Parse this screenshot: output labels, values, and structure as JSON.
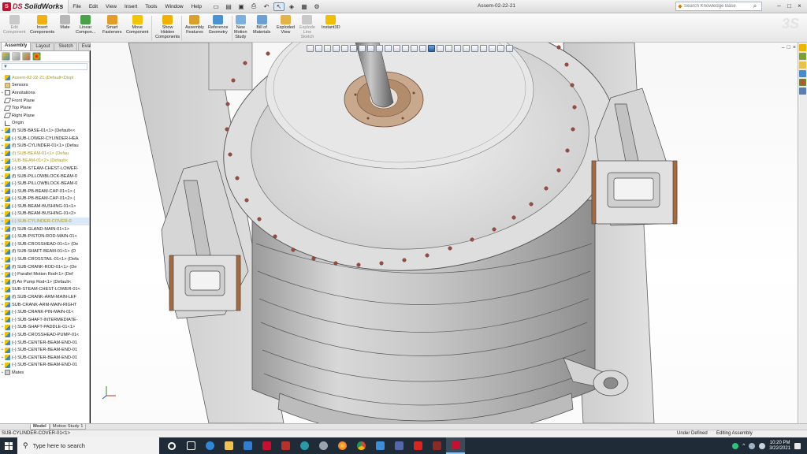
{
  "app": {
    "logo_mark": "S",
    "logo_prefix": "DS ",
    "logo_name": "SolidWorks",
    "document_title": "Assem-02-22-21"
  },
  "menu": [
    "File",
    "Edit",
    "View",
    "Insert",
    "Tools",
    "Window",
    "Help"
  ],
  "search": {
    "placeholder": "Search Knowledge Base"
  },
  "commands": [
    {
      "label": "Edit\nComponent",
      "icon_color": "#c9c9c9",
      "enabled": false
    },
    {
      "label": "Insert\nComponents",
      "icon_color": "#f3b10f",
      "enabled": true
    },
    {
      "label": "Mate",
      "icon_color": "#b7b7b7",
      "enabled": true
    },
    {
      "label": "Linear\nCompon...",
      "icon_color": "#4aa14a",
      "enabled": true
    },
    {
      "label": "Smart\nFasteners",
      "icon_color": "#e39b2a",
      "enabled": true
    },
    {
      "label": "Move\nComponent",
      "icon_color": "#f2c500",
      "enabled": true
    },
    {
      "label": "Show\nHidden\nComponents",
      "icon_color": "#f0b400",
      "enabled": true
    },
    {
      "label": "Assembly\nFeatures",
      "icon_color": "#d9a02a",
      "enabled": true
    },
    {
      "label": "Reference\nGeometry",
      "icon_color": "#4a93d0",
      "enabled": true
    },
    {
      "label": "New\nMotion\nStudy",
      "icon_color": "#7cb0e0",
      "enabled": true
    },
    {
      "label": "Bill of\nMaterials",
      "icon_color": "#6d9fd2",
      "enabled": true
    },
    {
      "label": "Exploded\nView",
      "icon_color": "#e2b445",
      "enabled": true
    },
    {
      "label": "Explode\nLine\nSketch",
      "icon_color": "#c9c9c9",
      "enabled": false
    },
    {
      "label": "Instant3D",
      "icon_color": "#f0c000",
      "enabled": true
    }
  ],
  "panel_tabs": [
    "Assembly",
    "Layout",
    "Sketch",
    "Evaluate"
  ],
  "tree": [
    {
      "label": "Assem-02-22-21  (Default<Displ",
      "icon": "asm",
      "exp": "",
      "style": "yellow"
    },
    {
      "label": "Sensors",
      "icon": "sensor",
      "exp": "",
      "style": ""
    },
    {
      "label": "Annotations",
      "icon": "annot",
      "exp": "+",
      "style": ""
    },
    {
      "label": "Front Plane",
      "icon": "plane",
      "exp": "",
      "style": ""
    },
    {
      "label": "Top Plane",
      "icon": "plane",
      "exp": "",
      "style": ""
    },
    {
      "label": "Right Plane",
      "icon": "plane",
      "exp": "",
      "style": ""
    },
    {
      "label": "Origin",
      "icon": "origin",
      "exp": "",
      "style": ""
    },
    {
      "label": "(f) SUB-BASE-01<1> (Default<<",
      "icon": "asm",
      "exp": "+",
      "style": ""
    },
    {
      "label": "(-) SUB-LOWER-CYLINDER-HEA",
      "icon": "asm",
      "exp": "+",
      "style": ""
    },
    {
      "label": "(f) SUB-CYLINDER-01<1> (Defau",
      "icon": "asm",
      "exp": "+",
      "style": ""
    },
    {
      "label": "(f) SUB-BEAM-01<1> (Defau",
      "icon": "asm",
      "exp": "+",
      "style": "yellow"
    },
    {
      "label": "SUB-BEAM-01<2> (Default<",
      "icon": "asm",
      "exp": "+",
      "style": "yellow"
    },
    {
      "label": "(-) SUB-STEAM-CHEST-LOWER-",
      "icon": "asm",
      "exp": "+",
      "style": ""
    },
    {
      "label": "(f) SUB-PILLOWBLOCK-BEAM-0",
      "icon": "asm",
      "exp": "+",
      "style": ""
    },
    {
      "label": "(-) SUB-PILLOWBLOCK-BEAM-0",
      "icon": "asm",
      "exp": "+",
      "style": ""
    },
    {
      "label": "(-) SUB-PB-BEAM-CAP-01<1> (",
      "icon": "asm",
      "exp": "+",
      "style": ""
    },
    {
      "label": "(-) SUB-PB-BEAM-CAP-01<2> (",
      "icon": "asm",
      "exp": "+",
      "style": ""
    },
    {
      "label": "(-) SUB-BEAM-BUSHING-01<1>",
      "icon": "asm",
      "exp": "+",
      "style": ""
    },
    {
      "label": "(-) SUB-BEAM-BUSHING-01<2>",
      "icon": "asm",
      "exp": "+",
      "style": ""
    },
    {
      "label": "(-) SUB-CYLINDER-COVER-0",
      "icon": "asm",
      "exp": "+",
      "style": "yellow hl"
    },
    {
      "label": "(f) SUB-GLAND-MAIN-01<1>",
      "icon": "asm",
      "exp": "+",
      "style": ""
    },
    {
      "label": "(-) SUB-PISTON-ROD-MAIN-01<",
      "icon": "asm",
      "exp": "+",
      "style": ""
    },
    {
      "label": "(-) SUB-CROSSHEAD-01<1> (De",
      "icon": "asm",
      "exp": "+",
      "style": ""
    },
    {
      "label": "(f) SUB-SHAFT-BEAM-01<1> (D",
      "icon": "asm",
      "exp": "+",
      "style": ""
    },
    {
      "label": "(-) SUB-CROSSTAIL-01<1> (Defa",
      "icon": "asm",
      "exp": "+",
      "style": ""
    },
    {
      "label": "(f) SUB-CRANK-ROD-01<1> (De",
      "icon": "asm",
      "exp": "+",
      "style": ""
    },
    {
      "label": "(-) Parallel Motion Rod<1> (Def",
      "icon": "asm",
      "exp": "+",
      "style": ""
    },
    {
      "label": "(f) Air Pump Rod<1> (Default<",
      "icon": "asm",
      "exp": "+",
      "style": ""
    },
    {
      "label": "SUB-STEAM-CHEST-LOWER-01<",
      "icon": "asm",
      "exp": "+",
      "style": ""
    },
    {
      "label": "(f) SUB-CRANK-ARM-MAIN-LEF",
      "icon": "asm",
      "exp": "+",
      "style": ""
    },
    {
      "label": "SUB-CRANK-ARM-MAIN-RIGHT",
      "icon": "asm",
      "exp": "+",
      "style": ""
    },
    {
      "label": "(-) SUB-CRANK-PIN-MAIN-01<",
      "icon": "asm",
      "exp": "+",
      "style": ""
    },
    {
      "label": "(-) SUB-SHAFT-INTERMEDIATE-",
      "icon": "asm",
      "exp": "+",
      "style": ""
    },
    {
      "label": "(-) SUB-SHAFT-PADDLE-01<1>",
      "icon": "asm",
      "exp": "+",
      "style": ""
    },
    {
      "label": "(-) SUB-CROSSHEAD-PUMP-01<",
      "icon": "asm",
      "exp": "+",
      "style": ""
    },
    {
      "label": "(-) SUB-CENTER-BEAM-END-01",
      "icon": "asm",
      "exp": "+",
      "style": ""
    },
    {
      "label": "(-) SUB-CENTER-BEAM-END-01",
      "icon": "asm",
      "exp": "+",
      "style": ""
    },
    {
      "label": "(-) SUB-CENTER-BEAM-END-01",
      "icon": "asm",
      "exp": "+",
      "style": ""
    },
    {
      "label": "(-) SUB-CENTER-BEAM-END-01",
      "icon": "asm",
      "exp": "+",
      "style": ""
    },
    {
      "label": "Mates",
      "icon": "mate",
      "exp": "+",
      "style": ""
    }
  ],
  "bottom_tabs": [
    "Model",
    "Motion Study 1"
  ],
  "status": {
    "selection": "SUB-CYLINDER-COVER-01<1>",
    "state": "Under Defined",
    "mode": "Editing Assembly"
  },
  "taskbar": {
    "search_placeholder": "Type here to search",
    "time": "10:20 PM",
    "date": "3/22/2021"
  },
  "glyphs": {
    "search_go": "⌕",
    "win_ctrls": [
      "–",
      "□",
      "×"
    ],
    "search_mag": "⚲",
    "filter": "▼",
    "tray_up": "^"
  }
}
